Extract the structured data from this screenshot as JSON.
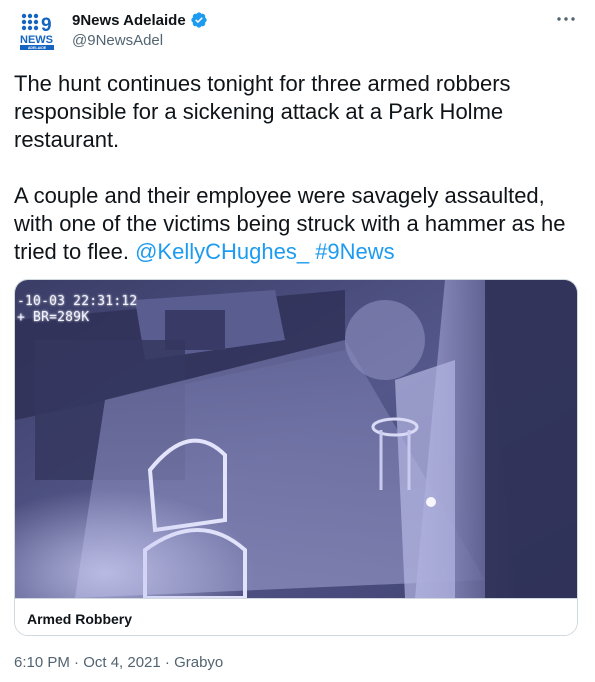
{
  "author": {
    "display_name": "9News Adelaide",
    "handle": "@9NewsAdel",
    "verified": true,
    "avatar_logo": {
      "dots_top": "⠿9",
      "word": "NEWS",
      "sub": "ADELAIDE"
    },
    "verified_icon": "verified-badge-icon",
    "more_icon": "more-options-icon"
  },
  "tweet": {
    "paragraph1": "The hunt continues tonight for three armed robbers responsible for a sickening attack at a Park Holme restaurant.",
    "paragraph2_text": "A couple and their employee were savagely assaulted, with one of the victims being struck with a hammer as he tried to flee.",
    "mention": "@KellyCHughes_",
    "hashtag": "#9News"
  },
  "media": {
    "cctv_line1": "-10-03 22:31:12",
    "cctv_line2": "+ BR=289K",
    "card_title": "Armed Robbery"
  },
  "meta": {
    "line": "6:10 PM · Oct 4, 2021 · Grabyo"
  },
  "colors": {
    "link": "#1d9bf0",
    "verified": "#1d9bf0",
    "logo_blue": "#1565c0",
    "secondary_text": "#536471",
    "border": "#cfd9de"
  }
}
